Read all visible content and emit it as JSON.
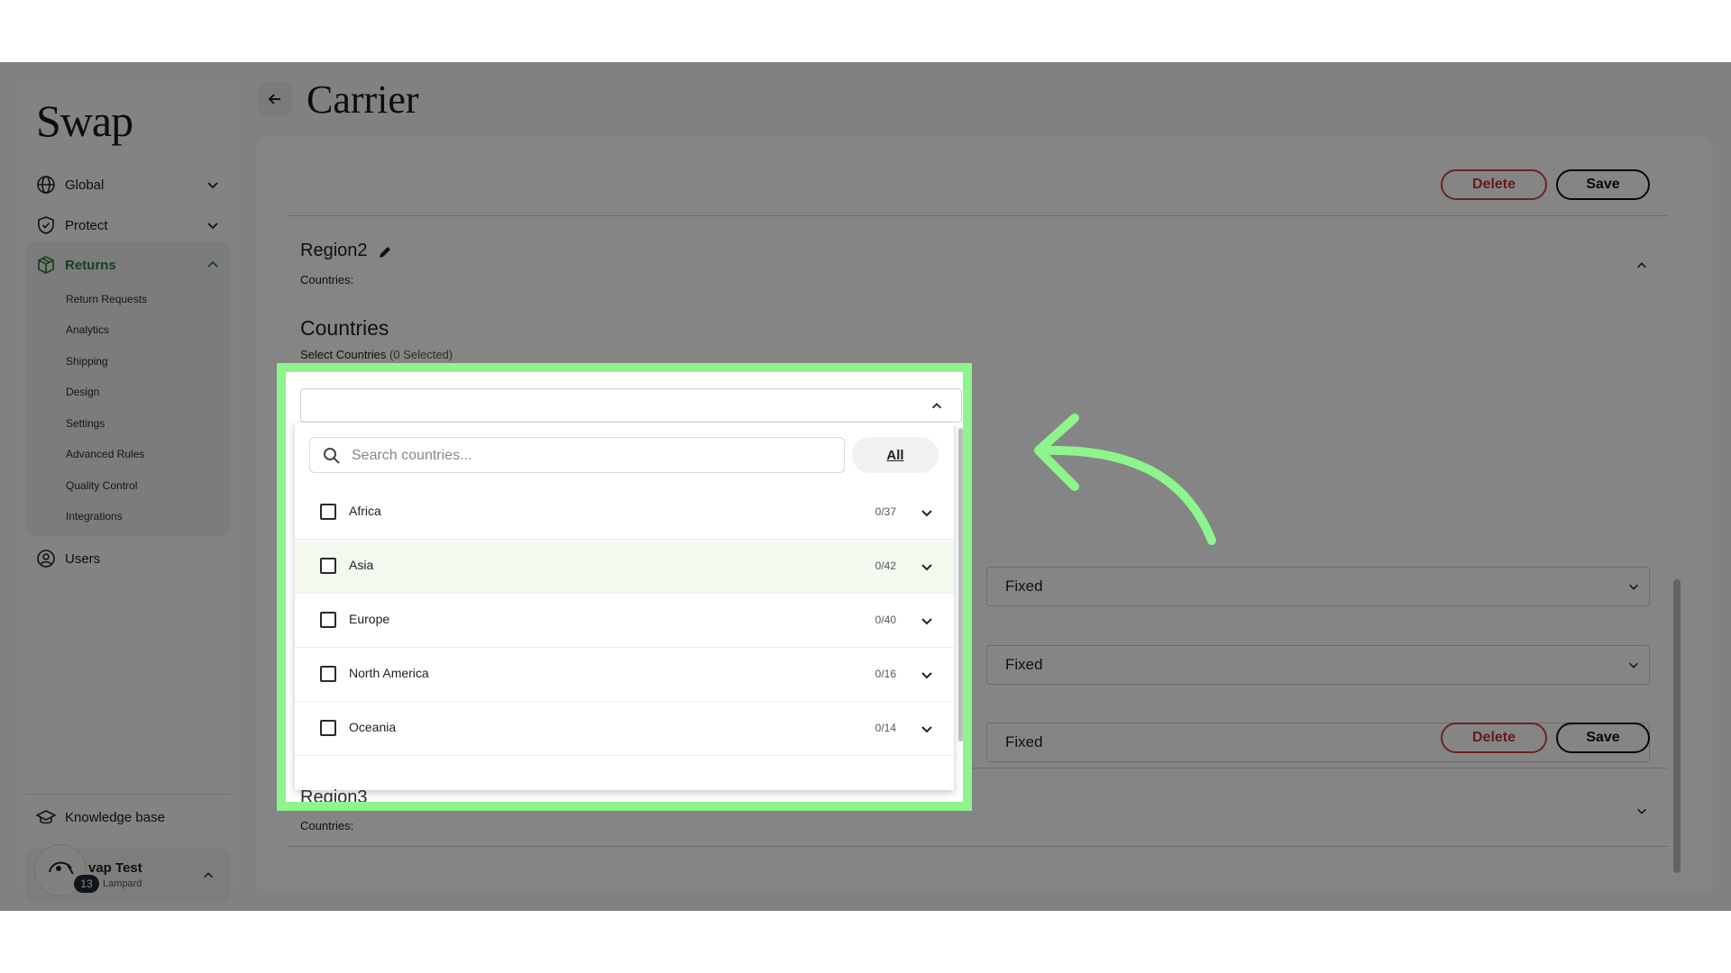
{
  "app": {
    "logo": "Swap",
    "page_title": "Carrier"
  },
  "sidebar": {
    "items": [
      {
        "label": "Global"
      },
      {
        "label": "Protect"
      },
      {
        "label": "Returns"
      },
      {
        "label": "Users"
      },
      {
        "label": "Knowledge base"
      }
    ],
    "returns_subitems": [
      "Return Requests",
      "Analytics",
      "Shipping",
      "Design",
      "Settings",
      "Advanced Rules",
      "Quality Control",
      "Integrations"
    ],
    "user": {
      "name": "vap Test",
      "org": "Lampard",
      "badge": "13"
    }
  },
  "actions": {
    "delete_label": "Delete",
    "save_label": "Save"
  },
  "region2": {
    "name": "Region2",
    "countries_label": "Countries:",
    "section_title": "Countries",
    "select_label": "Select Countries",
    "selected_count": "(0 Selected)",
    "rates": [
      "Fixed",
      "Fixed",
      "Fixed"
    ]
  },
  "region3": {
    "name": "Region3",
    "countries_label": "Countries:"
  },
  "dropdown": {
    "search_placeholder": "Search countries...",
    "all_label": "All",
    "continents": [
      {
        "name": "Africa",
        "count": "0/37"
      },
      {
        "name": "Asia",
        "count": "0/42"
      },
      {
        "name": "Europe",
        "count": "0/40"
      },
      {
        "name": "North America",
        "count": "0/16"
      },
      {
        "name": "Oceania",
        "count": "0/14"
      }
    ]
  },
  "colors": {
    "highlight": "#8ef58c",
    "returns_accent": "#2f7d3a",
    "delete": "#c33"
  }
}
